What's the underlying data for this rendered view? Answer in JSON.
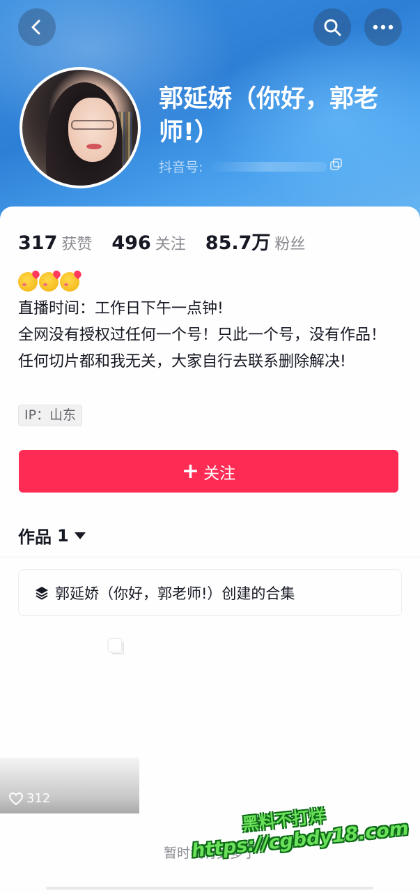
{
  "header": {
    "name": "郭延娇（你好，郭老师!）",
    "douyin_id_label": "抖音号:",
    "icons": {
      "back": "chevron-left-icon",
      "search": "search-icon",
      "more": "more-dots-icon",
      "copy": "copy-icon"
    }
  },
  "stats": [
    {
      "value": "317",
      "label": "获赞"
    },
    {
      "value": "496",
      "label": "关注"
    },
    {
      "value": "85.7万",
      "label": "粉丝"
    }
  ],
  "bio": {
    "emoji": "🥰🥰🥰",
    "lines": [
      "直播时间：工作日下午一点钟!",
      "全网没有授权过任何一个号！只此一个号，没有作品！任何切片都和我无关，大家自行去联系删除解决!"
    ],
    "ip": "IP：山东"
  },
  "follow_button": {
    "plus": "+",
    "label": "关注"
  },
  "works_tab": {
    "label": "作品",
    "count": "1"
  },
  "collection": {
    "label": "郭延娇（你好，郭老师!）创建的合集"
  },
  "video": {
    "likes": "312"
  },
  "footer": {
    "no_more": "暂时没有更多了"
  },
  "watermark": {
    "top": "黑料不打烊",
    "url": "https://cgbdy18.com"
  },
  "colors": {
    "accent": "#fe2c55",
    "header": "#2d7fd6",
    "watermark": "#6be05a"
  }
}
